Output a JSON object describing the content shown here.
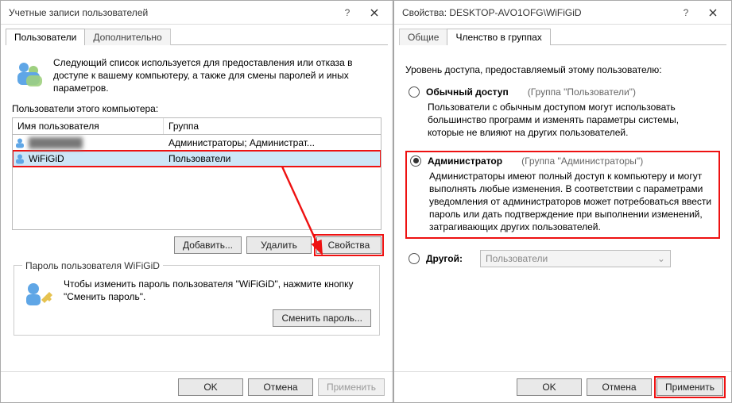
{
  "left": {
    "title": "Учетные записи пользователей",
    "tabs": {
      "tab1": "Пользователи",
      "tab2": "Дополнительно"
    },
    "intro": "Следующий список используется для предоставления или отказа в доступе к вашему компьютеру, а также для смены паролей и иных параметров.",
    "list_label": "Пользователи этого компьютера:",
    "cols": {
      "name": "Имя пользователя",
      "group": "Группа"
    },
    "rows": [
      {
        "name": "████████",
        "group": "Администраторы; Администрат..."
      },
      {
        "name": "WiFiGiD",
        "group": "Пользователи"
      }
    ],
    "buttons": {
      "add": "Добавить...",
      "remove": "Удалить",
      "props": "Свойства"
    },
    "pw_group_title": "Пароль пользователя WiFiGiD",
    "pw_text": "Чтобы изменить пароль пользователя \"WiFiGiD\", нажмите кнопку \"Сменить пароль\".",
    "pw_btn": "Сменить пароль...",
    "footer": {
      "ok": "OK",
      "cancel": "Отмена",
      "apply": "Применить"
    }
  },
  "right": {
    "title": "Свойства: DESKTOP-AVO1OFG\\WiFiGiD",
    "tabs": {
      "tab1": "Общие",
      "tab2": "Членство в группах"
    },
    "heading": "Уровень доступа, предоставляемый этому пользователю:",
    "opt_std": {
      "label": "Обычный доступ",
      "group": "(Группа \"Пользователи\")",
      "desc": "Пользователи с обычным доступом могут использовать большинство программ и изменять параметры системы, которые не влияют на других пользователей."
    },
    "opt_admin": {
      "label": "Администратор",
      "group": "(Группа \"Администраторы\")",
      "desc": "Администраторы имеют полный доступ к компьютеру и могут выполнять любые изменения. В соответствии с параметрами уведомления от администраторов может потребоваться ввести пароль или дать подтверждение при выполнении изменений, затрагивающих других пользователей."
    },
    "opt_other": {
      "label": "Другой:",
      "combo": "Пользователи"
    },
    "footer": {
      "ok": "OK",
      "cancel": "Отмена",
      "apply": "Применить"
    }
  }
}
